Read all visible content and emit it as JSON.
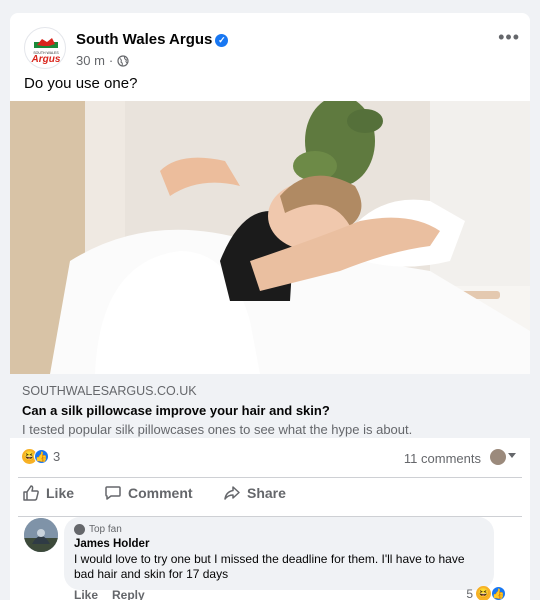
{
  "post": {
    "page_name": "South Wales Argus",
    "time": "30 m",
    "separator": "·",
    "caption": "Do you use one?",
    "avatar_text": "Argus",
    "avatar_small_text": "SOUTH WALES",
    "more_label": "•••"
  },
  "link": {
    "domain": "SOUTHWALESARGUS.CO.UK",
    "title": "Can a silk pillowcase improve your hair and skin?",
    "description": "I tested popular silk pillowcases ones to see what the hype is about."
  },
  "stats": {
    "reaction_count": "3",
    "comments": "11 comments"
  },
  "actions": {
    "like": "Like",
    "comment": "Comment",
    "share": "Share"
  },
  "comment": {
    "badge": "Top fan",
    "author": "James Holder",
    "text": "I would love to try one but I missed the deadline for them. I'll have to have bad hair and skin for 17 days",
    "like_label": "Like",
    "reply_label": "Reply",
    "reaction_count": "5"
  },
  "colors": {
    "brand_blue": "#1877f2",
    "secondary_text": "#65676b",
    "argus_red": "#d9251c"
  }
}
